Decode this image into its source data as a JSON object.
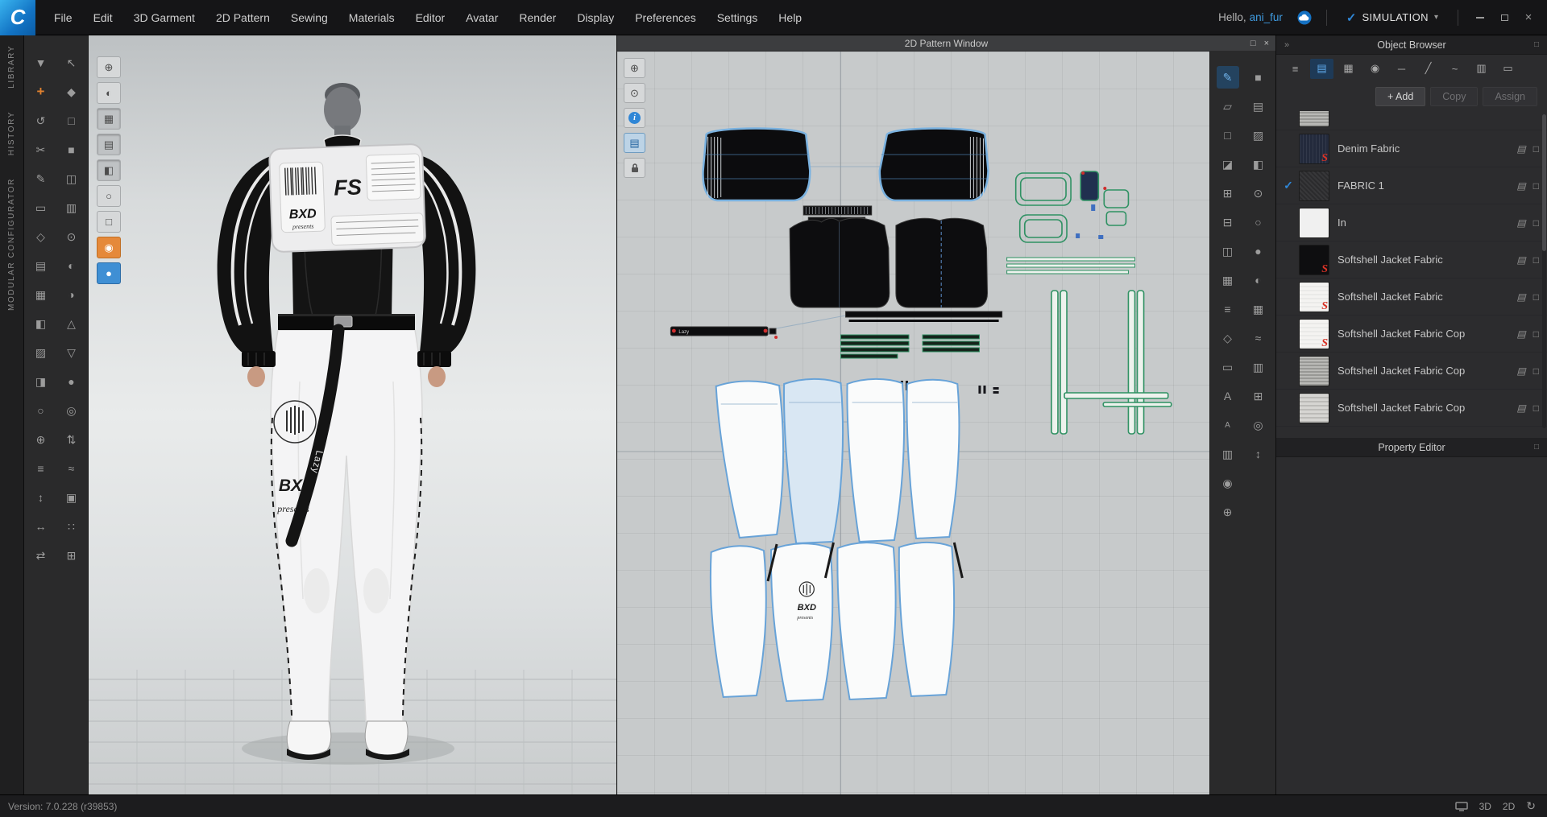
{
  "app": {
    "logo_text": "C",
    "greeting": "Hello,",
    "username": "ani_fur",
    "sim_check": "✓",
    "simulation_label": "SIMULATION",
    "sim_caret": "▾",
    "win_close": "×"
  },
  "menu": {
    "items": [
      "File",
      "Edit",
      "3D Garment",
      "2D Pattern",
      "Sewing",
      "Materials",
      "Editor",
      "Avatar",
      "Render",
      "Display",
      "Preferences",
      "Settings",
      "Help"
    ]
  },
  "left_rail": {
    "tabs": [
      "LIBRARY",
      "HISTORY",
      "MODULAR CONFIGURATOR"
    ]
  },
  "left_toolbar": {
    "col1": [
      {
        "g": "▼"
      },
      {
        "g": "+",
        "cls": "hl-orange"
      },
      {
        "g": "↺"
      },
      {
        "g": "✂"
      },
      {
        "g": "✎"
      },
      {
        "g": "▭"
      },
      {
        "g": "◇"
      },
      {
        "g": "▤"
      },
      {
        "g": "▦"
      },
      {
        "g": "◧"
      },
      {
        "g": "▨"
      },
      {
        "g": "◨"
      },
      {
        "g": "○"
      },
      {
        "g": "⊕"
      },
      {
        "g": "≡"
      },
      {
        "g": "↕"
      },
      {
        "g": "↔"
      },
      {
        "g": "⇄"
      }
    ],
    "col2": [
      {
        "g": "↖"
      },
      {
        "g": "◆"
      },
      {
        "g": "□"
      },
      {
        "g": "■"
      },
      {
        "g": "◫"
      },
      {
        "g": "▥"
      },
      {
        "g": "⊙"
      },
      {
        "g": "◐"
      },
      {
        "g": "◑"
      },
      {
        "g": "△"
      },
      {
        "g": "▽"
      },
      {
        "g": "●"
      },
      {
        "g": "◎"
      },
      {
        "g": "⇅"
      },
      {
        "g": "≈"
      },
      {
        "g": "▣"
      },
      {
        "g": "∷"
      },
      {
        "g": "⊞"
      }
    ]
  },
  "viewport3d": {
    "overlay_tools": [
      {
        "g": "⊕"
      },
      {
        "g": "◐"
      },
      {
        "g": "▦",
        "cls": "pressed"
      },
      {
        "g": "▤",
        "cls": "pressed"
      },
      {
        "g": "◧",
        "cls": "pressed"
      },
      {
        "g": "○"
      },
      {
        "g": "□"
      },
      {
        "g": "◉",
        "cls": "hl-orange"
      },
      {
        "g": "●",
        "cls": "hl-blue"
      }
    ],
    "garment": {
      "chest_logo": "FS",
      "brand": "BXD",
      "script": "presents",
      "strap_text": "Lazy"
    }
  },
  "pattern_window": {
    "title": "2D Pattern Window",
    "float_icon": "□",
    "close_icon": "×",
    "left_tools": {
      "zoom": "⊕",
      "pan": "⊙",
      "info": "i",
      "fabric": "▤"
    },
    "labels": {
      "belt_text": "Lazy",
      "logo": "BXD",
      "script": "presents"
    }
  },
  "right_toolbar": {
    "col1": [
      {
        "g": "✎",
        "cls": "hl-blue"
      },
      {
        "g": "▱"
      },
      {
        "g": "□"
      },
      {
        "g": "◪"
      },
      {
        "g": "⊞"
      },
      {
        "g": "⊟"
      },
      {
        "g": "◫"
      },
      {
        "g": "▦"
      },
      {
        "g": "≡"
      },
      {
        "g": "◇"
      },
      {
        "g": "▭"
      },
      {
        "g": "A"
      },
      {
        "g": "A",
        "cls": "small"
      },
      {
        "g": "▥"
      },
      {
        "g": "◉"
      },
      {
        "g": "⊕"
      }
    ],
    "col2": [
      {
        "g": "■"
      },
      {
        "g": "▤"
      },
      {
        "g": "▨"
      },
      {
        "g": "◧"
      },
      {
        "g": "⊙"
      },
      {
        "g": "○"
      },
      {
        "g": "●"
      },
      {
        "g": "◐"
      },
      {
        "g": "▦"
      },
      {
        "g": "≈"
      },
      {
        "g": "▥"
      },
      {
        "g": "⊞"
      },
      {
        "g": "◎"
      },
      {
        "g": "↕"
      }
    ]
  },
  "object_browser": {
    "title": "Object Browser",
    "expand_icon": "»",
    "dock_icon": "□",
    "toolbar_icons": [
      {
        "g": "≡"
      },
      {
        "g": "▤",
        "cls": "active"
      },
      {
        "g": "▦"
      },
      {
        "g": "◉"
      },
      {
        "g": "─"
      },
      {
        "g": "╱"
      },
      {
        "g": "~"
      },
      {
        "g": "▥"
      },
      {
        "g": "▭"
      }
    ],
    "buttons": {
      "add": "+ Add",
      "copy": "Copy",
      "assign": "Assign"
    },
    "row_icon_a": "▤",
    "row_icon_b": "□",
    "fabrics": [
      {
        "name": "",
        "thumb": "th-knit",
        "logo": "",
        "check": "",
        "cls": "partial"
      },
      {
        "name": "Denim Fabric",
        "thumb": "th-denim",
        "logo": "S",
        "check": ""
      },
      {
        "name": "FABRIC 1",
        "thumb": "th-dark",
        "logo": "",
        "check": "✓"
      },
      {
        "name": "In",
        "thumb": "th-white",
        "logo": "",
        "check": ""
      },
      {
        "name": "Softshell Jacket Fabric",
        "thumb": "th-black",
        "logo": "S",
        "check": ""
      },
      {
        "name": "Softshell Jacket Fabric",
        "thumb": "th-offwhite",
        "logo": "S",
        "check": ""
      },
      {
        "name": "Softshell Jacket Fabric Cop",
        "thumb": "th-offwhite",
        "logo": "S",
        "check": ""
      },
      {
        "name": "Softshell Jacket Fabric Cop",
        "thumb": "th-knit",
        "logo": "",
        "check": ""
      },
      {
        "name": "Softshell Jacket Fabric Cop",
        "thumb": "th-hatch",
        "logo": "",
        "check": ""
      }
    ]
  },
  "property_editor": {
    "title": "Property Editor",
    "dock_icon": "□"
  },
  "status_bar": {
    "version": "Version: 7.0.228 (r39853)",
    "toggle_3d": "3D",
    "toggle_2d": "2D",
    "refresh_icon": "↻"
  }
}
